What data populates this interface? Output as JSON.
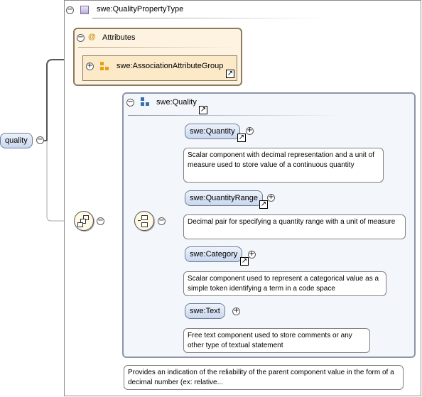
{
  "root_element": {
    "label": "quality"
  },
  "type": {
    "title": "swe:QualityPropertyType"
  },
  "attributes": {
    "title": "Attributes",
    "group": "swe:AssociationAttributeGroup"
  },
  "quality_group": {
    "title": "swe:Quality"
  },
  "children": [
    {
      "label": "swe:Quantity",
      "doc": "Scalar component with decimal representation and a unit of measure used to store value of a continuous quantity"
    },
    {
      "label": "swe:QuantityRange",
      "doc": "Decimal pair for specifying a quantity range with a unit of measure"
    },
    {
      "label": "swe:Category",
      "doc": "Scalar component used to represent a categorical value as a simple token identifying a term in a code space"
    },
    {
      "label": "swe:Text",
      "doc": "Free text component used to store comments or any other type of textual statement"
    }
  ],
  "root_doc": "Provides an indication of the reliability of the parent component value in the form of a decimal number (ex: relative...",
  "colors": {
    "element_fill": "#c9d7ef",
    "attribute_fill": "#fdf3e0",
    "group_fill": "#f3f6fb",
    "compositor_fill": "#fff8e4"
  }
}
